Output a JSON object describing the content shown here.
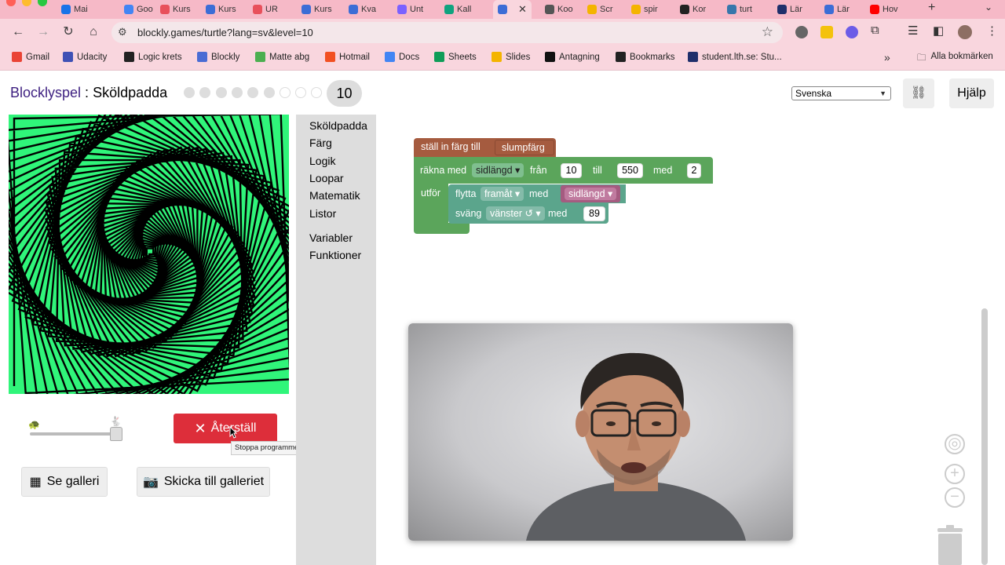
{
  "browser": {
    "tabs": [
      {
        "label": "Mai",
        "color": "#1a73e8"
      },
      {
        "label": "Goo",
        "color": "#4285f4"
      },
      {
        "label": "Kurs",
        "color": "#e8505b"
      },
      {
        "label": "Kurs",
        "color": "#3c6dd6"
      },
      {
        "label": "UR",
        "color": "#e8505b"
      },
      {
        "label": "Kurs",
        "color": "#3c6dd6"
      },
      {
        "label": "Kva",
        "color": "#3c6dd6"
      },
      {
        "label": "Unt",
        "color": "#7b61ff"
      },
      {
        "label": "Kall",
        "color": "#10a37f"
      },
      {
        "label": "",
        "color": "#3c6dd6"
      },
      {
        "label": "Koo",
        "color": "#555555"
      },
      {
        "label": "Scr",
        "color": "#f4b400"
      },
      {
        "label": "spir",
        "color": "#f4b400"
      },
      {
        "label": "Kor",
        "color": "#222222"
      },
      {
        "label": "turt",
        "color": "#3776ab"
      },
      {
        "label": "Lär",
        "color": "#1f2f6b"
      },
      {
        "label": "Lär",
        "color": "#3c6dd6"
      },
      {
        "label": "Hov",
        "color": "#ff0000"
      }
    ],
    "active_tab_close": "✕",
    "new_tab": "+",
    "url": "blockly.games/turtle?lang=sv&level=10",
    "bookmarks": [
      {
        "label": "Gmail",
        "color": "#ea4335"
      },
      {
        "label": "Udacity",
        "color": "#3f51b5"
      },
      {
        "label": "Logic krets",
        "color": "#222222"
      },
      {
        "label": "Blockly",
        "color": "#4a6cd4"
      },
      {
        "label": "Matte abg",
        "color": "#4caf50"
      },
      {
        "label": "Hotmail",
        "color": "#f25022"
      },
      {
        "label": "Docs",
        "color": "#4285f4"
      },
      {
        "label": "Sheets",
        "color": "#0f9d58"
      },
      {
        "label": "Slides",
        "color": "#f4b400"
      },
      {
        "label": "Antagning",
        "color": "#111111"
      },
      {
        "label": "Bookmarks",
        "color": "#222222"
      },
      {
        "label": "student.lth.se: Stu...",
        "color": "#1f2f6b"
      }
    ],
    "more": "»",
    "all_bookmarks": "Alla bokmärken"
  },
  "header": {
    "brand": "Blocklyspel",
    "separator": " : ",
    "game": "Sköldpadda",
    "level_total": 10,
    "current_level": "10",
    "language": "Svenska",
    "help": "Hjälp"
  },
  "controls": {
    "reset_label": "Återställ",
    "reset_tooltip": "Stoppa programmet och återställ nivån.",
    "gallery_label": "Se galleri",
    "submit_label": "Skicka till galleriet",
    "speed_level": 1.0
  },
  "toolbox": {
    "categories": [
      "Sköldpadda",
      "Färg",
      "Logik",
      "Loopar",
      "Matematik",
      "Listor"
    ],
    "categories2": [
      "Variabler",
      "Funktioner"
    ]
  },
  "program": {
    "set_color": "ställ in färg till",
    "random_color": "slumpfärg",
    "count_with": "räkna med",
    "var": "sidlängd",
    "from": "från",
    "from_val": "10",
    "to": "till",
    "to_val": "550",
    "by": "med",
    "by_val": "2",
    "do": "utför",
    "move": "flytta",
    "direction": "framåt",
    "move_by": "med",
    "turn": "sväng",
    "turn_dir": "vänster ↺",
    "turn_by": "med",
    "angle": "89"
  },
  "colors": {
    "canvas_bg": "#30f57a",
    "brand": "#3d1f80",
    "reset": "#dd2e3a"
  }
}
